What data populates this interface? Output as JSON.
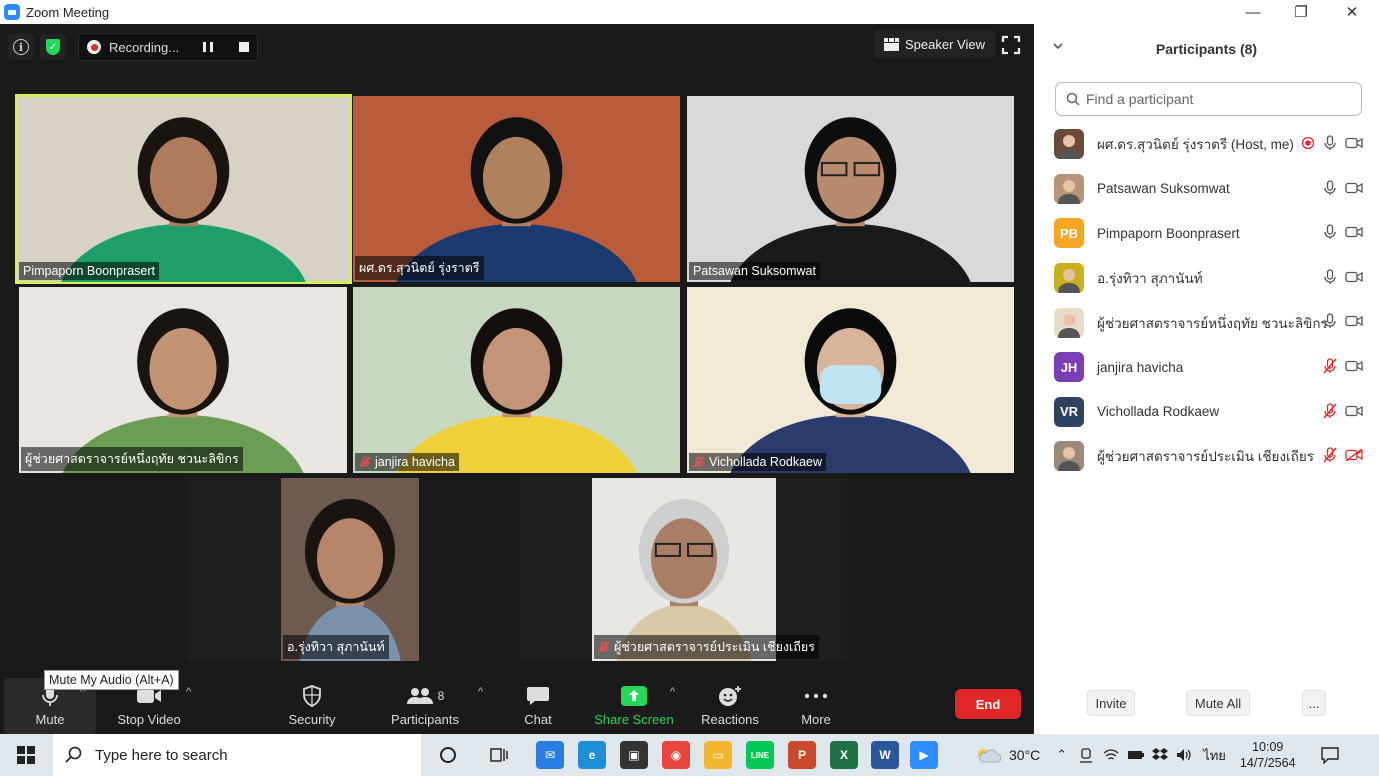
{
  "window": {
    "title": "Zoom Meeting",
    "minimize": "—",
    "restore": "❐",
    "close": "✕"
  },
  "topbar": {
    "recording_label": "Recording...",
    "speaker_view_label": "Speaker View"
  },
  "tiles": [
    {
      "name": "Pimpaporn Boonprasert",
      "muted": false,
      "active": true,
      "bg": "#d8d2c5",
      "skin": "#b07a5c",
      "shirt": "#1e9e6a",
      "hair": "#1a1410"
    },
    {
      "name": "ผศ.ดร.สุวนิตย์ รุ่งราตรี",
      "muted": false,
      "active": false,
      "bg": "#b85c3c",
      "skin": "#b0805f",
      "shirt": "#1d3a6e",
      "hair": "#111"
    },
    {
      "name": "Patsawan Suksomwat",
      "muted": false,
      "active": false,
      "bg": "#d9d9d9",
      "skin": "#b98b6e",
      "shirt": "#1a1a1a",
      "hair": "#0e0e0e"
    },
    {
      "name": "ผู้ช่วยศาสตราจารย์หนึ่งฤทัย ชวนะลิขิกร",
      "muted": false,
      "active": false,
      "bg": "#e9e6e2",
      "skin": "#c29374",
      "shirt": "#6b9e54",
      "hair": "#1a1410"
    },
    {
      "name": "janjira havicha",
      "muted": true,
      "active": false,
      "bg": "#c8d8c0",
      "skin": "#c49478",
      "shirt": "#f0d03a",
      "hair": "#140f0c"
    },
    {
      "name": "Vichollada Rodkaew",
      "muted": true,
      "active": false,
      "bg": "#efe9d6",
      "skin": "#d7b49a",
      "shirt": "#2b3b6b",
      "hair": "#0b0b0b"
    },
    {
      "name": "อ.รุ่งทิวา สุภานันท์",
      "muted": false,
      "active": false,
      "bg": "#6e5a4e",
      "skin": "#b7856a",
      "shirt": "#7a93ad",
      "hair": "#1a1410"
    },
    {
      "name": "ผู้ช่วยศาสตราจารย์ประเมิน เชียงเถียร",
      "muted": true,
      "active": false,
      "bg": "#e8e6e2",
      "skin": "#a97e66",
      "shirt": "#d8c8a6",
      "hair": "#cfcfcf"
    }
  ],
  "toolbar": {
    "mute": "Mute",
    "stop_video": "Stop Video",
    "security": "Security",
    "participants": "Participants",
    "participant_count": "8",
    "chat": "Chat",
    "share_screen": "Share Screen",
    "reactions": "Reactions",
    "more": "More",
    "end": "End",
    "tooltip": "Mute My Audio (Alt+A)"
  },
  "panel": {
    "title": "Participants (8)",
    "search_placeholder": "Find a participant",
    "participants": [
      {
        "name": "ผศ.ดร.สุวนิตย์ รุ่งราตรี (Host, me)",
        "initials": "",
        "avatar_color": "#6b4a3a",
        "mic_muted": false,
        "video_off": false,
        "recording": true
      },
      {
        "name": "Patsawan Suksomwat",
        "initials": "",
        "avatar_color": "#b89478",
        "mic_muted": false,
        "video_off": false,
        "recording": false
      },
      {
        "name": "Pimpaporn Boonprasert",
        "initials": "PB",
        "avatar_color": "#f5a623",
        "mic_muted": false,
        "video_off": false,
        "recording": false
      },
      {
        "name": "อ.รุ่งทิวา สุภานันท์",
        "initials": "",
        "avatar_color": "#c9b01e",
        "mic_muted": false,
        "video_off": false,
        "recording": false
      },
      {
        "name": "ผู้ช่วยศาสตราจารย์หนึ่งฤทัย ชวนะลิขิกร",
        "initials": "",
        "avatar_color": "#e8dcc8",
        "mic_muted": false,
        "video_off": false,
        "recording": false
      },
      {
        "name": "janjira havicha",
        "initials": "JH",
        "avatar_color": "#7b3fb5",
        "mic_muted": true,
        "video_off": false,
        "recording": false
      },
      {
        "name": "Vichollada Rodkaew",
        "initials": "VR",
        "avatar_color": "#2c4460",
        "mic_muted": true,
        "video_off": false,
        "recording": false
      },
      {
        "name": "ผู้ช่วยศาสตราจารย์ประเมิน เชียงเถียร",
        "initials": "",
        "avatar_color": "#9b8a7c",
        "mic_muted": true,
        "video_off": true,
        "recording": false
      }
    ],
    "invite": "Invite",
    "mute_all": "Mute All",
    "more": "..."
  },
  "taskbar": {
    "search_placeholder": "Type here to search",
    "weather": "30°C",
    "lang": "ไทย",
    "time": "10:09",
    "date": "14/7/2564",
    "apps": [
      {
        "name": "mail-app-icon",
        "color": "#2a7de1",
        "glyph": "✉"
      },
      {
        "name": "edge-app-icon",
        "color": "#1d8fd6",
        "glyph": "e"
      },
      {
        "name": "store-app-icon",
        "color": "#333333",
        "glyph": "▣"
      },
      {
        "name": "chrome-app-icon",
        "color": "#e8453c",
        "glyph": "◉"
      },
      {
        "name": "explorer-app-icon",
        "color": "#f2b72e",
        "glyph": "▭"
      },
      {
        "name": "line-app-icon",
        "color": "#06c755",
        "glyph": "LINE"
      },
      {
        "name": "powerpoint-app-icon",
        "color": "#c94a2a",
        "glyph": "P"
      },
      {
        "name": "excel-app-icon",
        "color": "#1e7145",
        "glyph": "X"
      },
      {
        "name": "word-app-icon",
        "color": "#2b579a",
        "glyph": "W"
      },
      {
        "name": "zoom-app-icon",
        "color": "#2d8cff",
        "glyph": "▶"
      }
    ]
  }
}
